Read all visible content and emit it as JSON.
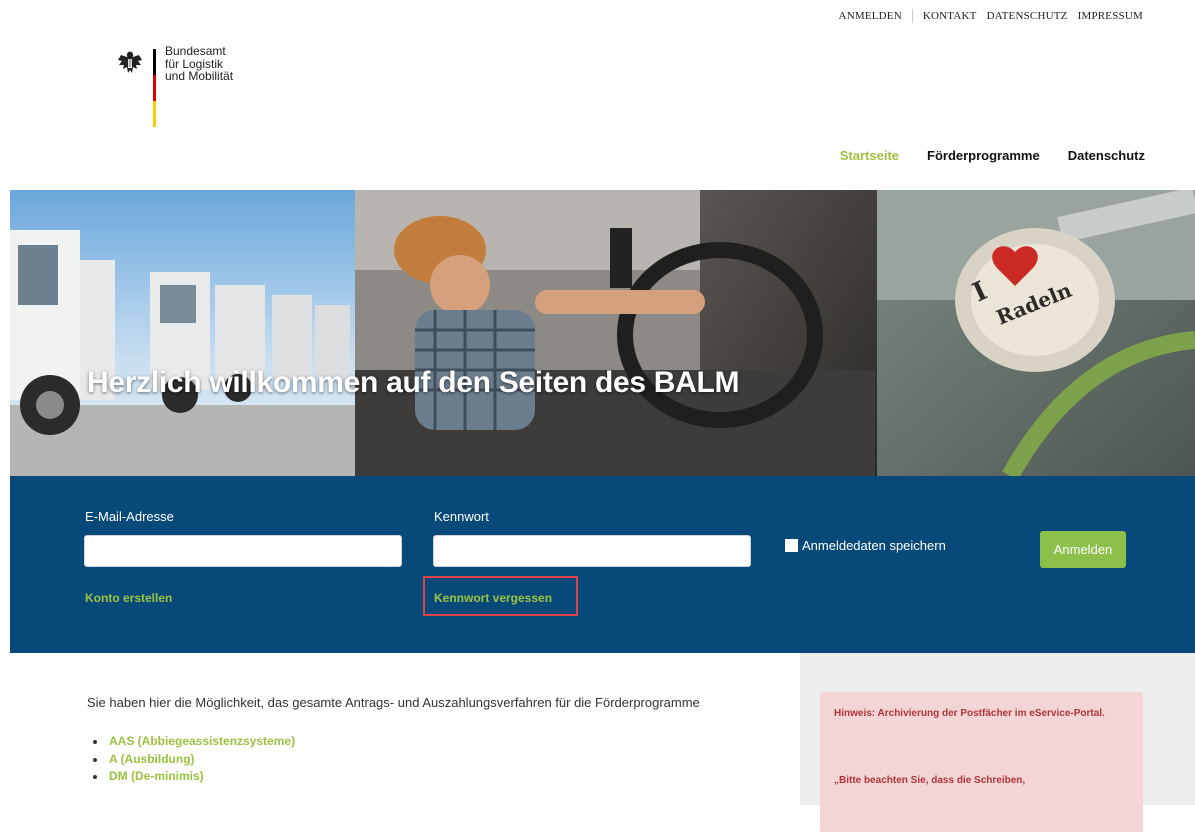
{
  "util_nav": {
    "login": "ANMELDEN",
    "contact": "KONTAKT",
    "privacy": "DATENSCHUTZ",
    "imprint": "IMPRESSUM"
  },
  "logo": {
    "name": "Bundesamt\nfür Logistik\nund Mobilität",
    "flag_colors": [
      "#000000",
      "#dd0000",
      "#ffcc00"
    ]
  },
  "main_nav": [
    {
      "label": "Startseite",
      "active": true
    },
    {
      "label": "Förderprogramme",
      "active": false
    },
    {
      "label": "Datenschutz",
      "active": false
    }
  ],
  "hero": {
    "title": "Herzlich willkommen auf den Seiten des BALM",
    "bell_text": "Radeln"
  },
  "login": {
    "email_label": "E-Mail-Adresse",
    "email_value": "",
    "password_label": "Kennwort",
    "password_value": "",
    "remember_label": "Anmeldedaten speichern",
    "remember_checked": false,
    "submit_label": "Anmelden",
    "create_account": "Konto erstellen",
    "forgot_password": "Kennwort vergessen"
  },
  "content": {
    "intro": "Sie haben hier die Möglichkeit, das gesamte Antrags- und Auszahlungsverfahren für die Förderprogramme",
    "programs": [
      "AAS (Abbiegeassistenzsysteme)",
      "A (Ausbildung)",
      "DM (De-minimis)"
    ]
  },
  "sidebar": {
    "notice_title": "Hinweis: Archivierung der Postfächer im eService-Portal.",
    "notice_text": "„Bitte beachten Sie, dass die Schreiben,"
  },
  "colors": {
    "accent_green": "#9cc241",
    "login_band": "#074a7a",
    "notice_bg": "#f4d5d6",
    "notice_text": "#b0343a",
    "highlight": "#e0424a"
  }
}
